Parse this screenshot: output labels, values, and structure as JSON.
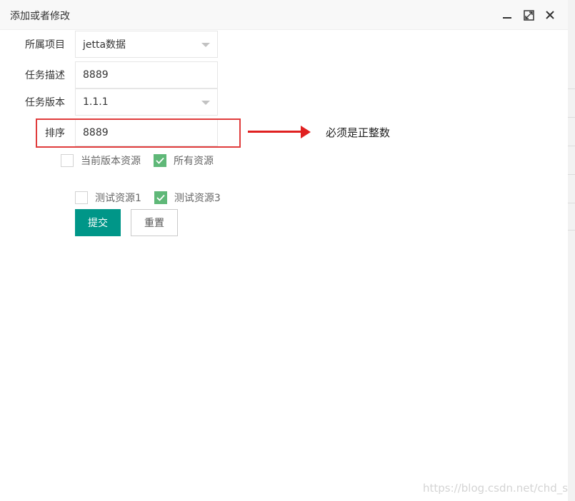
{
  "window": {
    "title": "添加或者修改",
    "icons": [
      "minimize-icon",
      "maximize-icon",
      "close-icon"
    ]
  },
  "form": {
    "project": {
      "label": "所属项目",
      "value": "jetta数据"
    },
    "description": {
      "label": "任务描述",
      "value": "8889"
    },
    "version": {
      "label": "任务版本",
      "value": "1.1.1"
    },
    "sort": {
      "label": "排序",
      "value": "8889"
    }
  },
  "annotation": {
    "note": "必须是正整数",
    "color": "#e02020"
  },
  "resource_scope": [
    {
      "label": "当前版本资源",
      "checked": false
    },
    {
      "label": "所有资源",
      "checked": true
    }
  ],
  "resources": [
    {
      "label": "测试资源1",
      "checked": false
    },
    {
      "label": "测试资源3",
      "checked": true
    }
  ],
  "buttons": {
    "submit": "提交",
    "reset": "重置"
  },
  "colors": {
    "primary": "#009688",
    "checkbox_checked": "#5fb878"
  },
  "watermark": "https://blog.csdn.net/chd_sun"
}
